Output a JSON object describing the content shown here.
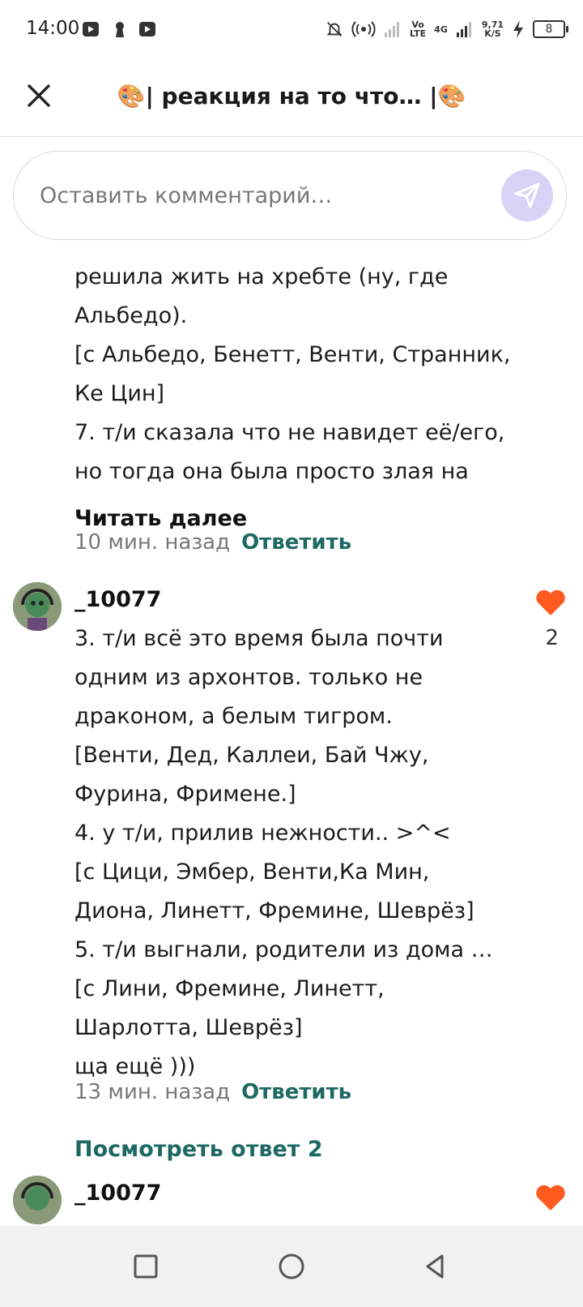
{
  "status": {
    "time": "14:00",
    "volte": "Vo\nLTE",
    "net_gen": "4G",
    "speed_val": "9,71",
    "speed_unit": "K/S",
    "battery": "8"
  },
  "header": {
    "title_left_emoji": "🎨",
    "title": "| реакция на то что… |",
    "title_right_emoji": "🎨"
  },
  "comment_box": {
    "placeholder": "Оставить комментарий…"
  },
  "comment1": {
    "lines": [
      "решила жить на хребте (ну, где",
      "Альбедо).",
      "[с Альбедо, Бенетт, Венти, Странник,",
      "Ке Цин]",
      "7. т/и сказала что не навидет её/его,",
      "но тогда она была просто злая на"
    ],
    "read_more": "Читать далее",
    "time": "10 мин. назад",
    "reply": "Ответить"
  },
  "comment2": {
    "username": "_10077",
    "like_count": "2",
    "lines": [
      "3. т/и всё это время была почти",
      "одним из архонтов. только не",
      "драконом, а белым тигром.",
      "[Венти, Дед, Каллеи, Бай Чжу,",
      "Фурина, Фримене.]",
      "4. у т/и, прилив нежности.. >^<",
      "[с Цици, Эмбер, Венти,Ка Мин,",
      "Диона, Линетт, Фремине, Шеврёз]",
      "5. т/и выгнали, родители из дома …",
      "[с Лини, Фремине, Линетт,",
      "Шарлотта, Шеврёз]",
      "ща ещё )))"
    ],
    "time": "13 мин. назад",
    "reply": "Ответить",
    "view_replies": "Посмотреть ответ 2"
  },
  "comment3": {
    "username": "_10077"
  },
  "colors": {
    "accent": "#1e6a63",
    "like": "#ff5a1f",
    "send_bg": "#d9d2f7"
  }
}
